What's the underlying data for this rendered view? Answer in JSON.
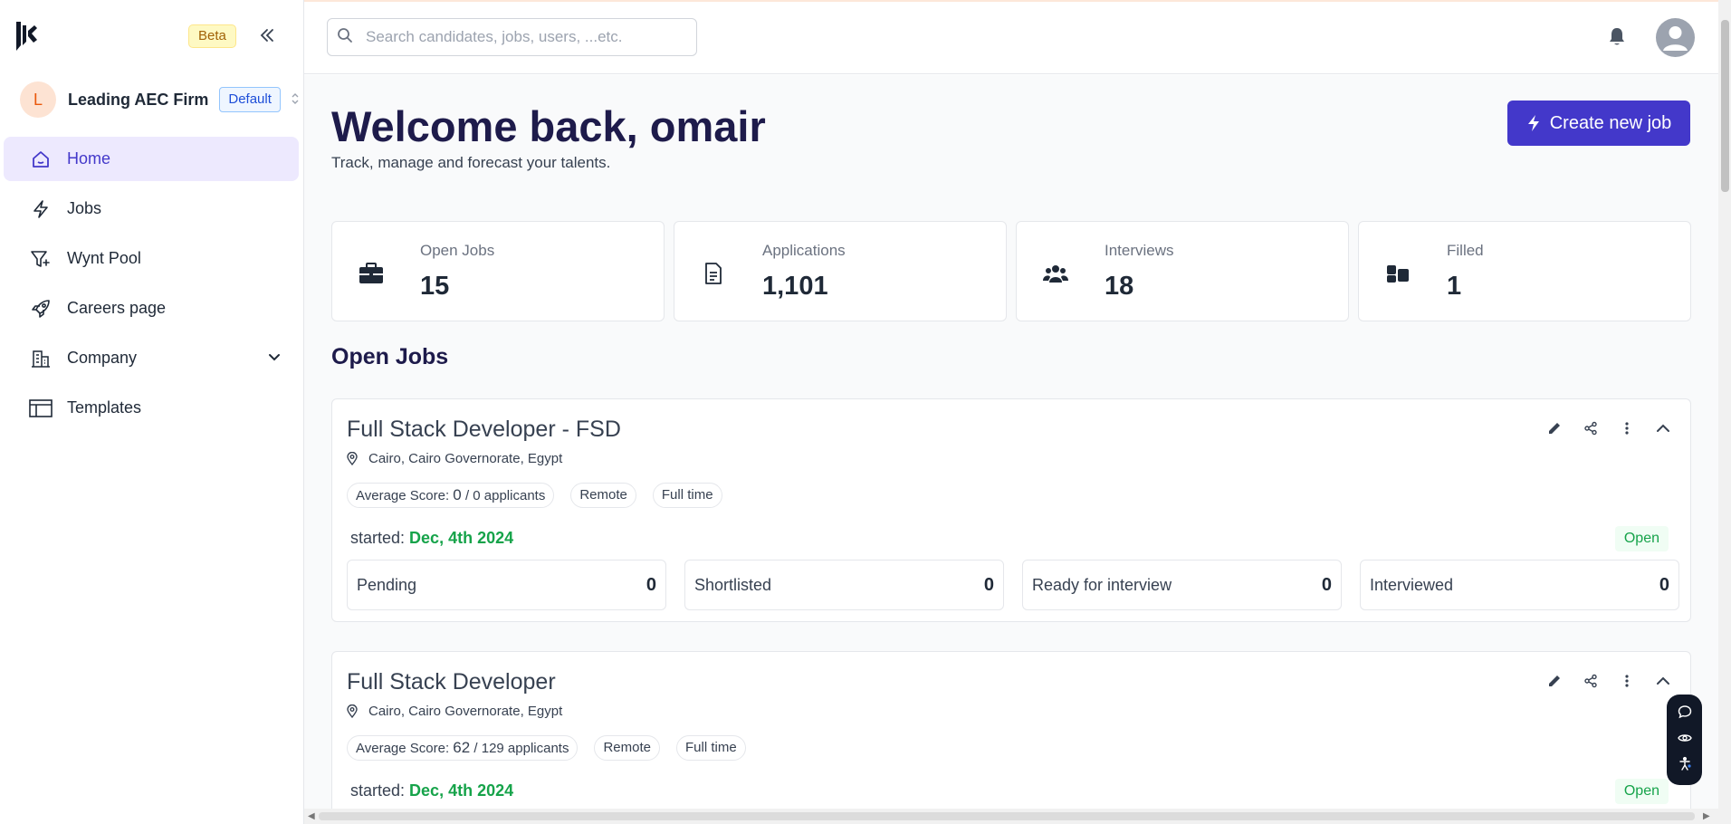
{
  "sidebar": {
    "beta_label": "Beta",
    "org": {
      "avatar_letter": "L",
      "name": "Leading AEC Firm",
      "badge": "Default"
    },
    "items": [
      {
        "label": "Home",
        "icon": "home-icon",
        "active": true
      },
      {
        "label": "Jobs",
        "icon": "bolt-icon"
      },
      {
        "label": "Wynt Pool",
        "icon": "filter-icon"
      },
      {
        "label": "Careers page",
        "icon": "rocket-icon"
      },
      {
        "label": "Company",
        "icon": "building-icon"
      },
      {
        "label": "Templates",
        "icon": "layout-icon"
      }
    ]
  },
  "header": {
    "search_placeholder": "Search candidates, jobs, users, ...etc."
  },
  "main": {
    "welcome": "Welcome back, omair",
    "subtitle": "Track, manage and forecast your talents.",
    "create_button": "Create new job",
    "stats": [
      {
        "label": "Open Jobs",
        "value": "15",
        "icon": "briefcase-icon"
      },
      {
        "label": "Applications",
        "value": "1,101",
        "icon": "document-icon"
      },
      {
        "label": "Interviews",
        "value": "18",
        "icon": "users-icon"
      },
      {
        "label": "Filled",
        "value": "1",
        "icon": "blocks-icon"
      }
    ],
    "section_title": "Open Jobs",
    "jobs": [
      {
        "title": "Full Stack Developer - FSD",
        "location": "Cairo, Cairo Governorate, Egypt",
        "avg_score_label": "Average Score:",
        "avg_score": "0",
        "applicants": "/ 0 applicants",
        "tags": [
          "Remote",
          "Full time"
        ],
        "started_label": "started:",
        "started_date": "Dec, 4th 2024",
        "status": "Open",
        "pipeline": [
          {
            "label": "Pending",
            "value": "0"
          },
          {
            "label": "Shortlisted",
            "value": "0"
          },
          {
            "label": "Ready for interview",
            "value": "0"
          },
          {
            "label": "Interviewed",
            "value": "0"
          }
        ]
      },
      {
        "title": "Full Stack Developer",
        "location": "Cairo, Cairo Governorate, Egypt",
        "avg_score_label": "Average Score:",
        "avg_score": "62",
        "applicants": "/ 129 applicants",
        "tags": [
          "Remote",
          "Full time"
        ],
        "started_label": "started:",
        "started_date": "Dec, 4th 2024",
        "status": "Open"
      }
    ]
  },
  "colors": {
    "accent": "#4338ca",
    "active_nav_bg": "#ede9fe",
    "success": "#16a34a"
  }
}
